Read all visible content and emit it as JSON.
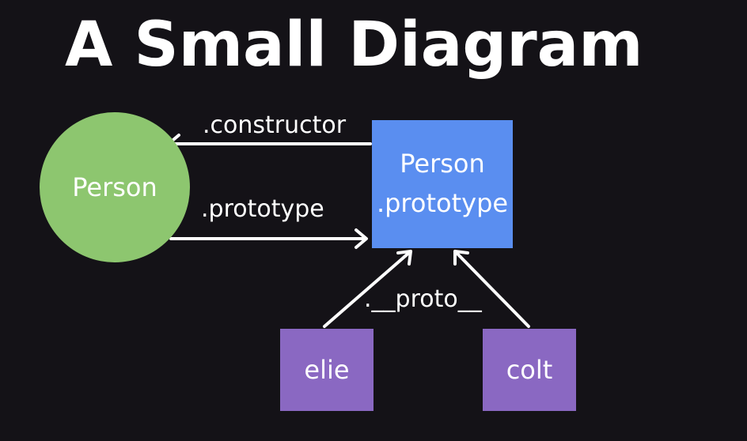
{
  "title": "A Small Diagram",
  "nodes": {
    "person": "Person",
    "prototype_line1": "Person",
    "prototype_line2": ".prototype",
    "elie": "elie",
    "colt": "colt"
  },
  "edges": {
    "constructor": ".constructor",
    "prototype": ".prototype",
    "proto": ".__proto__"
  },
  "colors": {
    "background": "#141217",
    "person_circle": "#8dc66f",
    "prototype_box": "#5a8ef0",
    "instance_box": "#8a68c2",
    "arrow": "#ffffff"
  }
}
